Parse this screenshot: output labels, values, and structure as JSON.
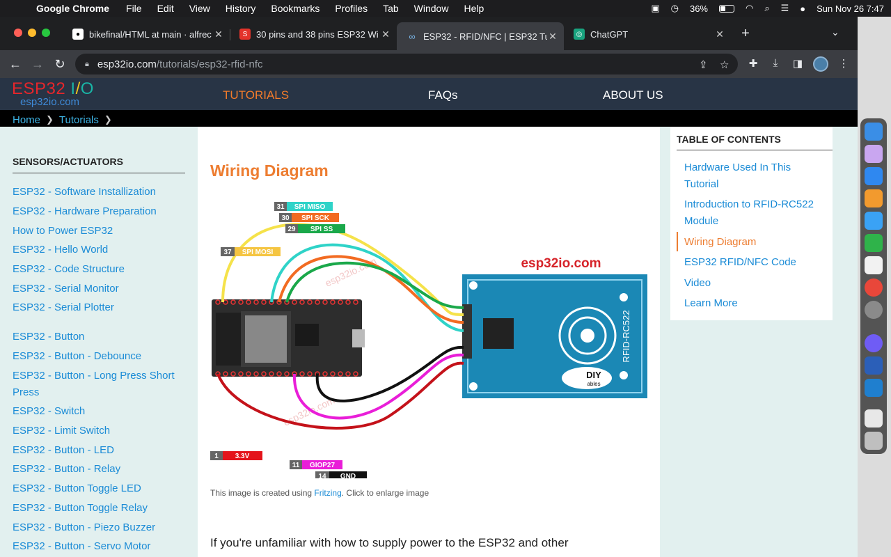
{
  "menubar": {
    "app_name": "Google Chrome",
    "items": [
      "File",
      "Edit",
      "View",
      "History",
      "Bookmarks",
      "Profiles",
      "Tab",
      "Window",
      "Help"
    ],
    "battery_percent": "36%",
    "datetime": "Sun Nov 26  7:47"
  },
  "tabs": [
    {
      "title": "bikefinal/HTML at main · alfrec",
      "icon": "github-icon"
    },
    {
      "title": "30 pins and 38 pins ESP32 Wi",
      "icon": "shop-icon"
    },
    {
      "title": "ESP32 - RFID/NFC | ESP32 Tut",
      "icon": "esp32io-icon"
    },
    {
      "title": "ChatGPT",
      "icon": "chatgpt-icon"
    }
  ],
  "address": {
    "host": "esp32io.com",
    "path": "/tutorials/esp32-rfid-nfc"
  },
  "site": {
    "logo_main_a": "ESP32",
    "logo_slash_i": "I",
    "logo_slash": "/",
    "logo_o": "O",
    "logo_sub": "esp32io.com",
    "nav": [
      "TUTORIALS",
      "FAQs",
      "ABOUT US"
    ]
  },
  "breadcrumb": [
    "Home",
    "Tutorials"
  ],
  "sidebar": {
    "title": "SENSORS/ACTUATORS",
    "links": [
      "ESP32 - Software Installization",
      "ESP32 - Hardware Preparation",
      "How to Power ESP32",
      "ESP32 - Hello World",
      "ESP32 - Code Structure",
      "ESP32 - Serial Monitor",
      "ESP32 - Serial Plotter",
      "ESP32 - Button",
      "ESP32 - Button - Debounce",
      "ESP32 - Button - Long Press Short Press",
      "ESP32 - Switch",
      "ESP32 - Limit Switch",
      "ESP32 - Button - LED",
      "ESP32 - Button - Relay",
      "ESP32 - Button Toggle LED",
      "ESP32 - Button Toggle Relay",
      "ESP32 - Button - Piezo Buzzer",
      "ESP32 - Button - Servo Motor"
    ]
  },
  "article": {
    "heading": "Wiring Diagram",
    "caption_prefix": "This image is created using ",
    "caption_link": "Fritzing",
    "caption_suffix": ". Click to enlarge image",
    "paragraph": "If you're unfamiliar with how to supply power to the ESP32 and other"
  },
  "diagram": {
    "brand": "esp32io.com",
    "watermark": "esp32io.com",
    "module_label": "RFID-RC522",
    "diy_logo": "DIY",
    "diy_sub": "ables",
    "pins": [
      {
        "num": "31",
        "label": "SPI MISO",
        "color": "#2fd3c8"
      },
      {
        "num": "30",
        "label": "SPI SCK",
        "color": "#f26b22"
      },
      {
        "num": "29",
        "label": "SPI SS",
        "color": "#1aa84a"
      },
      {
        "num": "37",
        "label": "SPI MOSI",
        "color": "#f5c542"
      },
      {
        "num": "1",
        "label": "3.3V",
        "color": "#e4141b"
      },
      {
        "num": "11",
        "label": "GIOP27",
        "color": "#e91ed8"
      },
      {
        "num": "14",
        "label": "GND",
        "color": "#111111"
      }
    ]
  },
  "toc": {
    "title": "TABLE OF CONTENTS",
    "links": [
      "Hardware Used In This Tutorial",
      "Introduction to RFID-RC522 Module",
      "Wiring Diagram",
      "ESP32 RFID/NFC Code",
      "Video",
      "Learn More"
    ]
  }
}
